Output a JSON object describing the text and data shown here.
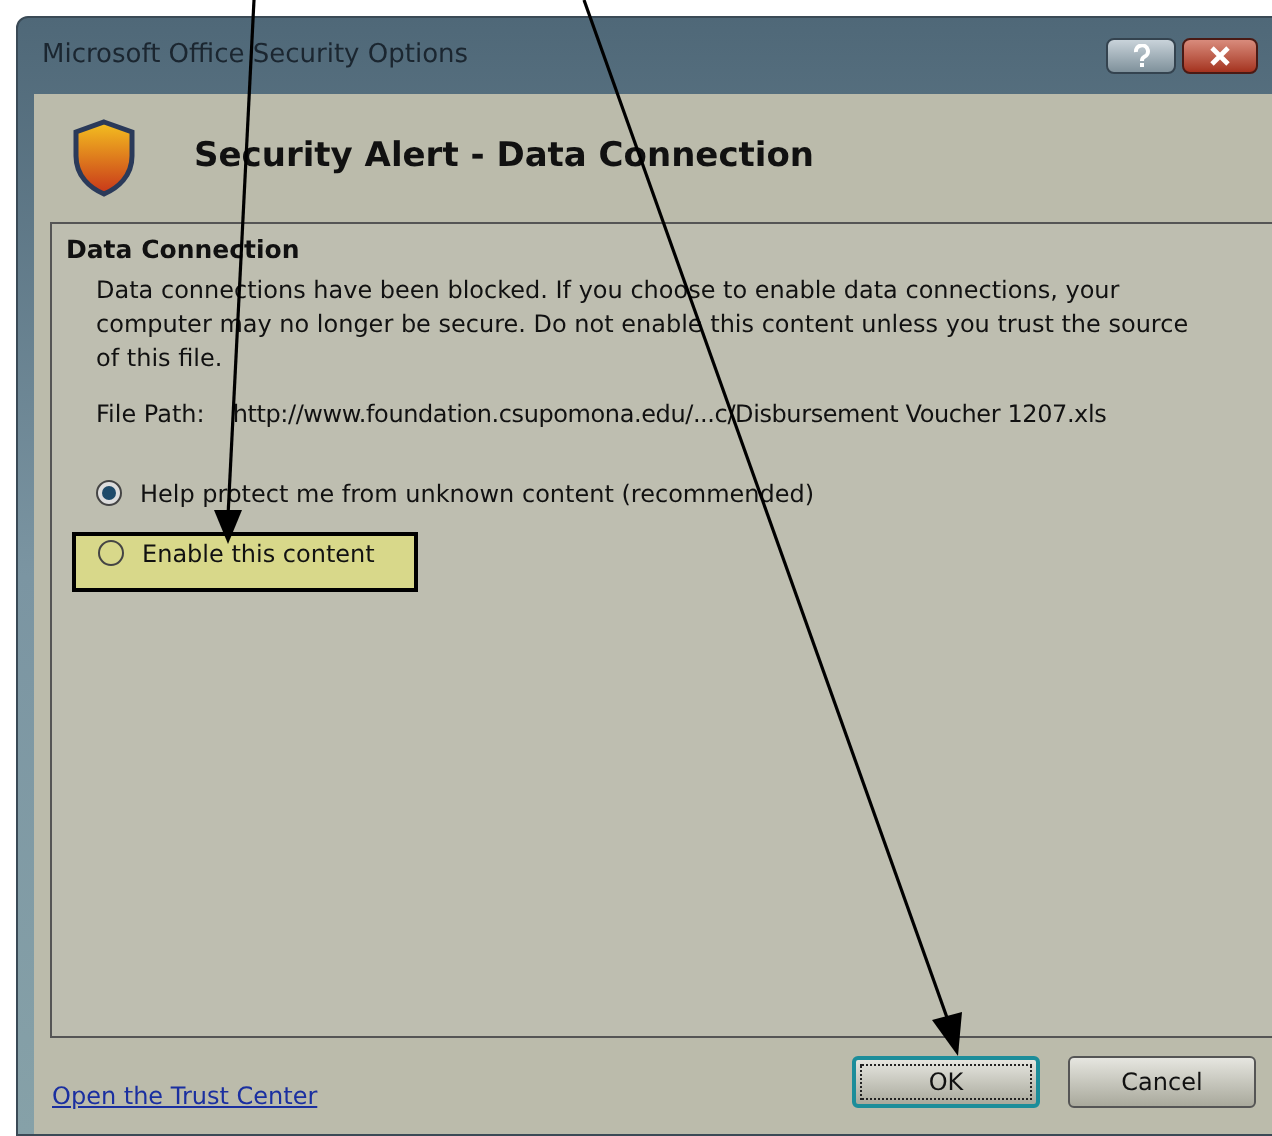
{
  "window": {
    "title": "Microsoft Office Security Options"
  },
  "header": {
    "title": "Security Alert - Data Connection"
  },
  "section": {
    "title": "Data Connection",
    "message": "Data connections have been blocked. If you choose to enable data connections, your computer may no longer be secure. Do not enable this content unless you trust the source of this file.",
    "file_path_label": "File Path:",
    "file_path": "http://www.foundation.csupomona.edu/...c/Disbursement Voucher 1207.xls"
  },
  "options": [
    {
      "label": "Help protect me from unknown content (recommended)",
      "selected": true,
      "highlighted": false
    },
    {
      "label": "Enable this content",
      "selected": false,
      "highlighted": true
    }
  ],
  "footer": {
    "link": "Open the Trust Center",
    "buttons": [
      {
        "label": "OK",
        "default": true
      },
      {
        "label": "Cancel",
        "default": false
      }
    ]
  }
}
